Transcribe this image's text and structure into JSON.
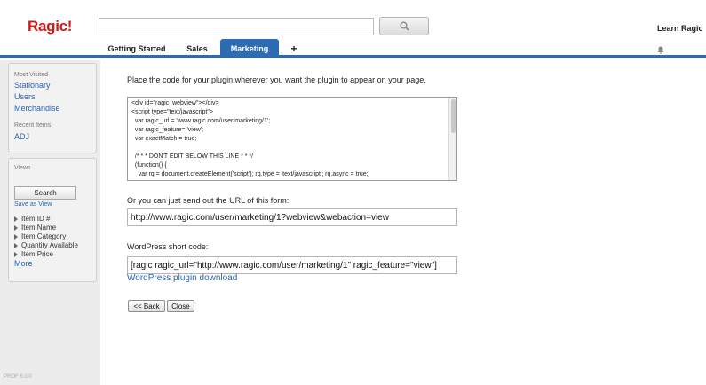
{
  "header": {
    "logo": "Ragic!",
    "search": {
      "value": "",
      "placeholder": ""
    },
    "learn": "Learn Ragic",
    "tabs": [
      {
        "label": "Getting Started"
      },
      {
        "label": "Sales"
      },
      {
        "label": "Marketing"
      },
      {
        "label": "+"
      }
    ],
    "accent_color": "#2b6cb3",
    "logo_color": "#d11a1a"
  },
  "sidebar": {
    "most_visited_title": "Most Visited",
    "most_visited": [
      "Stationary",
      "Users",
      "Merchandise"
    ],
    "recent_title": "Recent Items",
    "recent": [
      "ADJ"
    ],
    "views_title": "Views",
    "search_label": "Search",
    "save_as_view": "Save as View",
    "fields": [
      "Item ID #",
      "Item Name",
      "Item Category",
      "Quantity Available",
      "Item Price"
    ],
    "more": "More",
    "version": "PROF 6.0.0"
  },
  "main": {
    "intro": "Place the code for your plugin wherever you want the plugin to appear on your page.",
    "code_lines": [
      "<div id=\"ragic_webview\"></div>",
      "<script type=\"text/javascript\">",
      "  var ragic_url = 'www.ragic.com/user/marketing/1';",
      "  var ragic_feature= 'view';",
      "  var exactMatch = true;",
      "",
      "  /* * * DON'T EDIT BELOW THIS LINE * * */",
      "  (function() {",
      "    var rq = document.createElement('script'); rq.type = 'text/javascript'; rq.async = true;"
    ],
    "url_label": "Or you can just send out the URL of this form:",
    "url_value": "http://www.ragic.com/user/marketing/1?webview&webaction=view",
    "wp_label": "WordPress short code:",
    "wp_value": "[ragic ragic_url=\"http://www.ragic.com/user/marketing/1\" ragic_feature=\"view\"]",
    "wp_link": "WordPress plugin download",
    "back_label": "<< Back",
    "close_label": "Close"
  }
}
